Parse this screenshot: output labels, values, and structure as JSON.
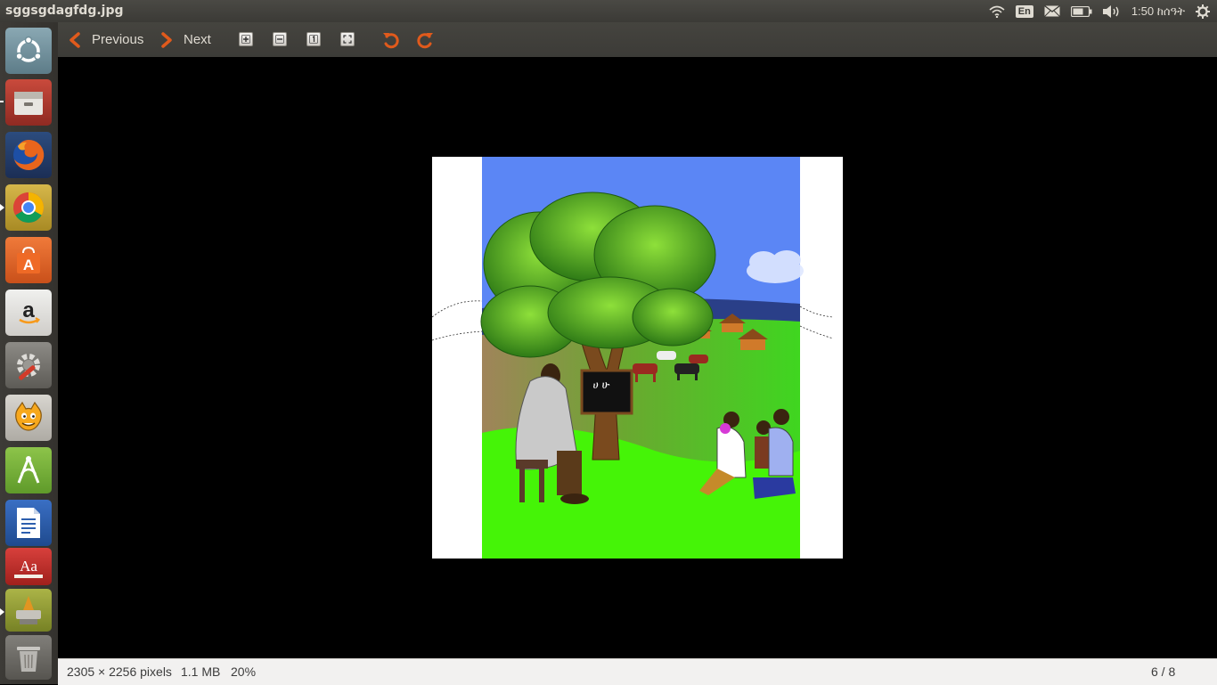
{
  "window": {
    "title": "sggsgdagfdg.jpg"
  },
  "panel": {
    "keyboard_layout": "En",
    "clock": "1:50 ከሰዓት"
  },
  "toolbar": {
    "previous_label": "Previous",
    "next_label": "Next",
    "zoom_buttons": [
      "zoom-in-icon",
      "zoom-out-icon",
      "zoom-normal-icon",
      "zoom-fit-icon"
    ],
    "rotate_buttons": [
      "rotate-left-icon",
      "rotate-right-icon"
    ]
  },
  "image": {
    "blackboard_text": "ሀ ሁ"
  },
  "status": {
    "dimensions": "2305 × 2256 pixels",
    "size": "1.1 MB",
    "zoom": "20%",
    "position": "6 / 8"
  },
  "launcher": {
    "items": [
      "ubuntu-dash-icon",
      "files-icon",
      "firefox-icon",
      "chrome-icon",
      "software-center-icon",
      "amazon-icon",
      "system-settings-icon",
      "scratch-icon",
      "android-studio-icon",
      "libreoffice-writer-icon",
      "dictionary-icon",
      "workspaces-icon",
      "trash-icon"
    ]
  },
  "colors": {
    "accent_orange": "#e05a1c",
    "sky": "#5b86f5",
    "grass": "#45f407",
    "panel_bg": "#3c3b37"
  }
}
